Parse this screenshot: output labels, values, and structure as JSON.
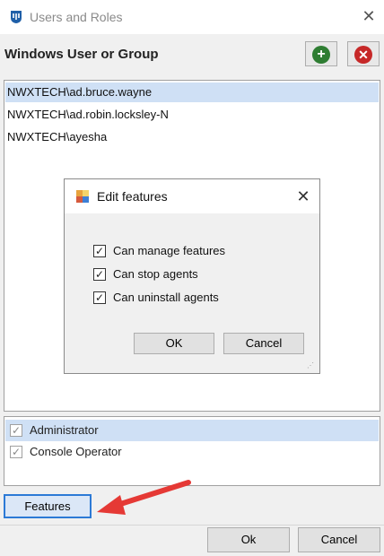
{
  "window": {
    "title": "Users and Roles",
    "icon": "app-shield-icon",
    "close_glyph": "✕"
  },
  "header": {
    "title": "Windows User or Group",
    "add_icon": "add-icon",
    "remove_icon": "remove-icon"
  },
  "users": [
    {
      "name": "NWXTECH\\ad.bruce.wayne",
      "selected": true
    },
    {
      "name": "NWXTECH\\ad.robin.locksley-N",
      "selected": false
    },
    {
      "name": "NWXTECH\\ayesha",
      "selected": false
    }
  ],
  "dialog": {
    "title": "Edit features",
    "icon": "features-icon",
    "close_glyph": "✕",
    "options": [
      {
        "label": "Can manage features",
        "checked": true
      },
      {
        "label": "Can stop agents",
        "checked": true
      },
      {
        "label": "Can uninstall agents",
        "checked": true
      }
    ],
    "ok_label": "OK",
    "cancel_label": "Cancel"
  },
  "roles": [
    {
      "label": "Administrator",
      "checked": true,
      "selected": true
    },
    {
      "label": "Console Operator",
      "checked": true,
      "selected": false
    }
  ],
  "footer": {
    "features_label": "Features",
    "ok_label": "Ok",
    "cancel_label": "Cancel"
  },
  "colors": {
    "selection": "#cfe0f5",
    "accent": "#2c7ad6",
    "arrow": "#e53935",
    "add": "#2e7d32",
    "remove": "#c62828"
  }
}
